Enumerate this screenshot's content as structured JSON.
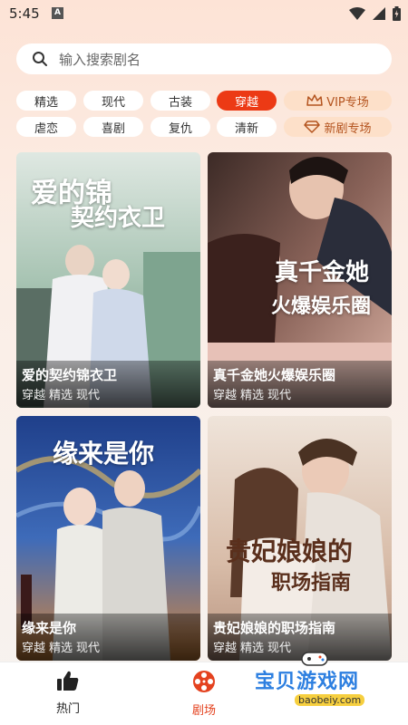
{
  "status_bar": {
    "time": "5:45",
    "notification_letter": "A"
  },
  "search": {
    "placeholder": "输入搜索剧名"
  },
  "filters": {
    "row1": [
      {
        "label": "精选"
      },
      {
        "label": "现代"
      },
      {
        "label": "古装"
      },
      {
        "label": "穿越"
      },
      {
        "label": "VIP专场"
      }
    ],
    "row2": [
      {
        "label": "虐恋"
      },
      {
        "label": "喜剧"
      },
      {
        "label": "复仇"
      },
      {
        "label": "清新"
      },
      {
        "label": "新剧专场"
      }
    ],
    "active": "穿越"
  },
  "dramas": [
    {
      "title": "爱的契约锦衣卫",
      "tags": [
        "穿越",
        "精选",
        "现代"
      ],
      "poster_text": [
        "爱的锦",
        "契约衣卫"
      ]
    },
    {
      "title": "真千金她火爆娱乐圈",
      "tags": [
        "穿越",
        "精选",
        "现代"
      ],
      "poster_text": [
        "真千金她",
        "火爆娱乐圈"
      ]
    },
    {
      "title": "缘来是你",
      "tags": [
        "穿越",
        "精选",
        "现代"
      ],
      "poster_text": [
        "缘来是你"
      ]
    },
    {
      "title": "贵妃娘娘的职场指南",
      "tags": [
        "穿越",
        "精选",
        "现代"
      ],
      "poster_text": [
        "贵妃娘娘的",
        "职场指南"
      ]
    }
  ],
  "bottom_nav": [
    {
      "label": "热门"
    },
    {
      "label": "剧场"
    }
  ],
  "watermark": {
    "text": "宝贝游戏网",
    "url": "baobeiy.com"
  },
  "colors": {
    "accent": "#ec3a15",
    "special_chip_bg": "#fde0c9",
    "special_chip_text": "#b4541f"
  }
}
